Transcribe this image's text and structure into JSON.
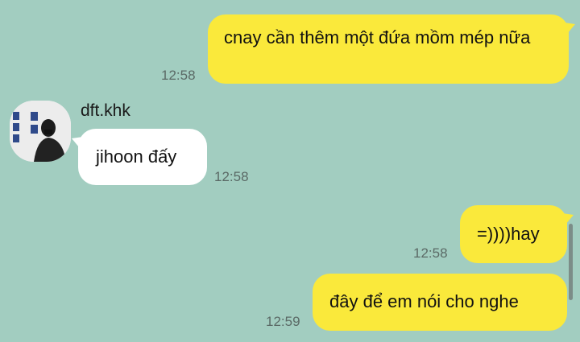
{
  "messages": [
    {
      "id": "m1",
      "from": "me",
      "text": "cnay cần thêm một đứa mồm mép nữa",
      "time": "12:58"
    },
    {
      "id": "m2",
      "from": "them",
      "sender": "dft.khk",
      "text": "jihoon đấy",
      "time": "12:58"
    },
    {
      "id": "m3",
      "from": "me",
      "text": "=))))hay",
      "time": "12:58"
    },
    {
      "id": "m4",
      "from": "me",
      "text": "đây để em nói cho nghe",
      "time": "12:59"
    }
  ],
  "colors": {
    "background": "#a2cdc0",
    "outgoing_bubble": "#fae93b",
    "incoming_bubble": "#ffffff"
  },
  "icons": {
    "avatar": "profile-photo"
  }
}
